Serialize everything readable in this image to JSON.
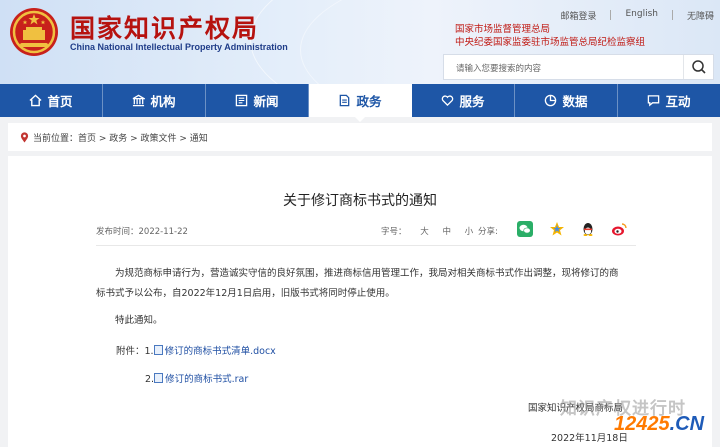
{
  "header": {
    "title_cn": "国家知识产权局",
    "title_en": "China National Intellectual Property Administration",
    "top_links": [
      "邮箱登录",
      "English",
      "无障碍"
    ],
    "gov_links": [
      "国家市场监督管理总局",
      "中央纪委国家监委驻市场监管总局纪检监察组"
    ]
  },
  "search": {
    "placeholder": "请输入您要搜索的内容",
    "icon": "search-icon"
  },
  "nav": {
    "items": [
      {
        "label": "首页",
        "icon": "home-icon"
      },
      {
        "label": "机构",
        "icon": "building-icon"
      },
      {
        "label": "新闻",
        "icon": "newspaper-icon"
      },
      {
        "label": "政务",
        "icon": "document-icon",
        "active": true
      },
      {
        "label": "服务",
        "icon": "heart-hands-icon"
      },
      {
        "label": "数据",
        "icon": "pie-chart-icon"
      },
      {
        "label": "互动",
        "icon": "chat-icon"
      }
    ]
  },
  "breadcrumb": {
    "prefix": "当前位置：",
    "path": "首页 > 政务 > 政策文件 > 通知"
  },
  "article": {
    "title": "关于修订商标书式的通知",
    "date_label": "发布时间：2022-11-22",
    "font_label": "字号：",
    "font_sizes": [
      "大",
      "中",
      "小"
    ],
    "share_label": "分享:",
    "share_icons": [
      "wechat-icon",
      "qzone-icon",
      "qq-icon",
      "weibo-icon"
    ],
    "paragraph1": "为规范商标申请行为，营造诚实守信的良好氛围，推进商标信用管理工作，我局对相关商标书式作出调整，现将修订的商标书式予以公布，自2022年12月1日启用，旧版书式将同时停止使用。",
    "paragraph2": "特此通知。",
    "attach_label": "附件：",
    "attachments": [
      {
        "index": "1.",
        "name": "修订的商标书式清单.docx"
      },
      {
        "index": "2.",
        "name": "修订的商标书式.rar"
      }
    ],
    "signature": "国家知识产权局商标局",
    "signature_date": "2022年11月18日"
  },
  "watermark": {
    "text": "知识产权进行时",
    "logo": "12425.CN",
    "colors": {
      "digits": "#ff7a00",
      "cn": "#1e5bb8"
    }
  },
  "colors": {
    "brand_red": "#b6120f",
    "nav_blue": "#1e56a6",
    "link_blue": "#1f4fa3"
  }
}
